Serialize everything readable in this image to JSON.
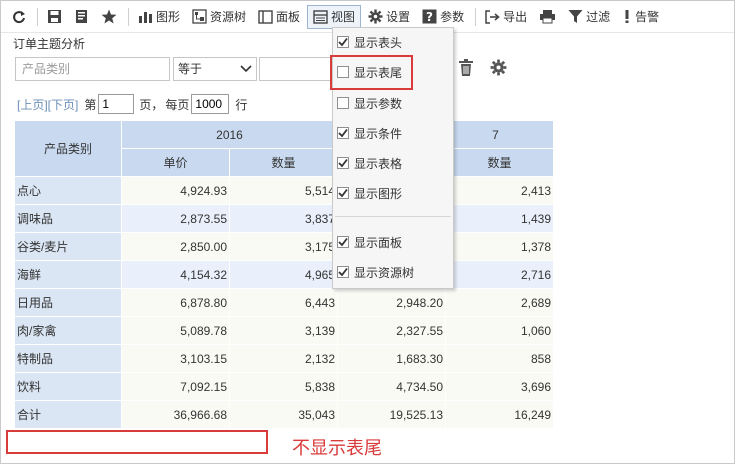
{
  "toolbar": {
    "items": [
      {
        "icon": "refresh-icon",
        "label": ""
      },
      {
        "icon": "save-icon",
        "label": ""
      },
      {
        "icon": "save-as-icon",
        "label": ""
      },
      {
        "icon": "star-icon",
        "label": ""
      },
      {
        "icon": "chart-icon",
        "label": "图形"
      },
      {
        "icon": "resource-tree-icon",
        "label": "资源树"
      },
      {
        "icon": "panel-icon",
        "label": "面板"
      },
      {
        "icon": "view-icon",
        "label": "视图"
      },
      {
        "icon": "gear-icon",
        "label": "设置"
      },
      {
        "icon": "question-icon",
        "label": "参数"
      },
      {
        "icon": "export-icon",
        "label": "导出"
      },
      {
        "icon": "print-icon",
        "label": "打印"
      },
      {
        "icon": "filter-icon",
        "label": "过滤"
      },
      {
        "icon": "alert-icon",
        "label": "告警"
      }
    ]
  },
  "subject": {
    "title": "订单主题分析"
  },
  "filter": {
    "field_placeholder": "产品类别",
    "operator": "等于",
    "value": ""
  },
  "pager": {
    "prev": "[上页]",
    "next": "[下页]",
    "page_prefix": "第",
    "page_value": "1",
    "page_suffix": "页，",
    "per_page_prefix": "每页",
    "per_page_value": "1000",
    "per_page_suffix": "行"
  },
  "table": {
    "row_header": "产品类别",
    "year1": "2016",
    "year2": "7",
    "sub_headers": [
      "单价",
      "数量",
      "",
      "数量"
    ],
    "rows": [
      {
        "cat": "点心",
        "c1": "4,924.93",
        "c2": "5,514",
        "c3": "",
        "c4": "2,413"
      },
      {
        "cat": "调味品",
        "c1": "2,873.55",
        "c2": "3,837",
        "c3": "",
        "c4": "1,439"
      },
      {
        "cat": "谷类/麦片",
        "c1": "2,850.00",
        "c2": "3,175",
        "c3": "",
        "c4": "1,378"
      },
      {
        "cat": "海鲜",
        "c1": "4,154.32",
        "c2": "4,965",
        "c3": "",
        "c4": "2,716"
      },
      {
        "cat": "日用品",
        "c1": "6,878.80",
        "c2": "6,443",
        "c3": "2,948.20",
        "c4": "2,689"
      },
      {
        "cat": "肉/家禽",
        "c1": "5,089.78",
        "c2": "3,139",
        "c3": "2,327.55",
        "c4": "1,060"
      },
      {
        "cat": "特制品",
        "c1": "3,103.15",
        "c2": "2,132",
        "c3": "1,683.30",
        "c4": "858"
      },
      {
        "cat": "饮料",
        "c1": "7,092.15",
        "c2": "5,838",
        "c3": "4,734.50",
        "c4": "3,696"
      },
      {
        "cat": "合计",
        "c1": "36,966.68",
        "c2": "35,043",
        "c3": "19,525.13",
        "c4": "16,249"
      }
    ]
  },
  "view_menu": {
    "items": [
      {
        "label": "显示表头",
        "checked": true
      },
      {
        "label": "显示表尾",
        "checked": false
      },
      {
        "label": "显示参数",
        "checked": false
      },
      {
        "label": "显示条件",
        "checked": true
      },
      {
        "label": "显示表格",
        "checked": true
      },
      {
        "label": "显示图形",
        "checked": true
      },
      {
        "label": "显示面板",
        "checked": true
      },
      {
        "label": "显示资源树",
        "checked": true
      }
    ]
  },
  "annotation": {
    "text": "不显示表尾"
  },
  "colors": {
    "accent_red": "#d93a3a",
    "header_blue": "#c9daf0",
    "cat_blue": "#dbe6f4"
  }
}
